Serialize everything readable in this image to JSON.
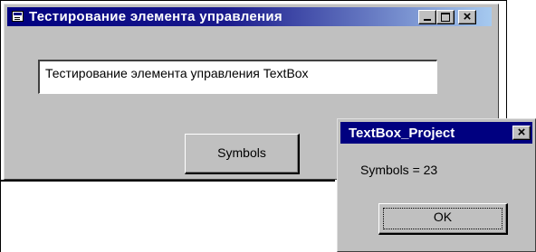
{
  "main_window": {
    "title": "Тестирование элемента управления",
    "textbox_value": "Тестирование элемента управления TextBox",
    "symbols_button_label": "Symbols",
    "close_glyph": "×",
    "title_gradient": [
      "#000080",
      "#a6caf0"
    ]
  },
  "message_box": {
    "title": "TextBox_Project",
    "message": "Symbols = 23",
    "ok_label": "OK",
    "close_glyph": "×",
    "title_color": "#000080"
  }
}
